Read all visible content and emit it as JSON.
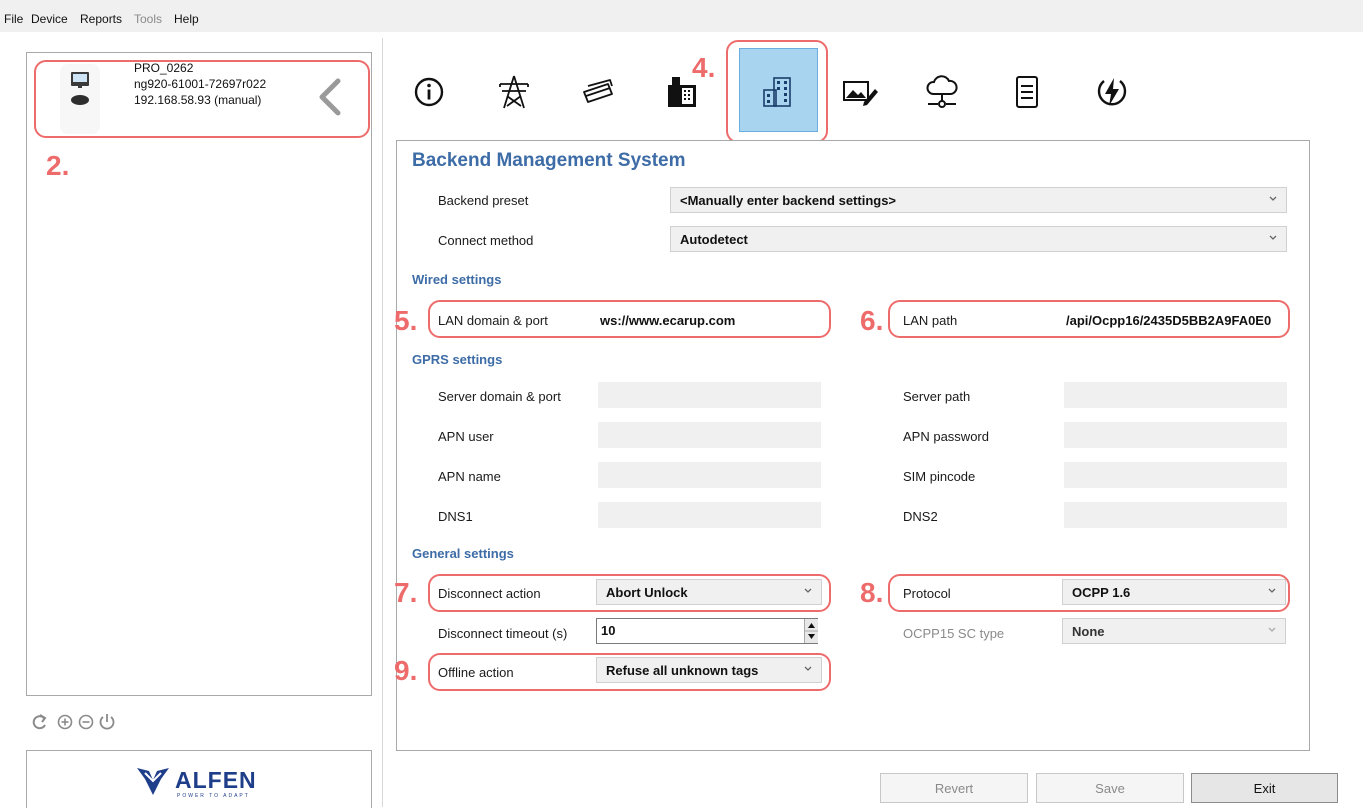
{
  "menu": {
    "file": "File",
    "device": "Device",
    "reports": "Reports",
    "tools": "Tools",
    "help": "Help"
  },
  "device": {
    "name": "PRO_0262",
    "id": "ng920-61001-72697r022",
    "address": "192.168.58.93 (manual)"
  },
  "annotations": {
    "n2": "2.",
    "n4": "4.",
    "n5": "5.",
    "n6": "6.",
    "n7": "7.",
    "n8": "8.",
    "n9": "9."
  },
  "toolbar": {
    "icons": [
      "info-icon",
      "power-tower-icon",
      "cards-icon",
      "cash-register-icon",
      "buildings-icon",
      "image-edit-icon",
      "cloud-network-icon",
      "document-icon",
      "power-bolt-icon"
    ],
    "selected_index": 4
  },
  "backend": {
    "title": "Backend Management System",
    "preset_label": "Backend preset",
    "preset_value": "<Manually enter backend settings>",
    "connect_label": "Connect method",
    "connect_value": "Autodetect"
  },
  "wired": {
    "title": "Wired settings",
    "lan_domain_label": "LAN domain & port",
    "lan_domain_value": "ws://www.ecarup.com",
    "lan_path_label": "LAN path",
    "lan_path_value": "/api/Ocpp16/2435D5BB2A9FA0E0"
  },
  "gprs": {
    "title": "GPRS settings",
    "server_domain_label": "Server domain & port",
    "server_domain_value": "",
    "server_path_label": "Server path",
    "server_path_value": "",
    "apn_user_label": "APN user",
    "apn_user_value": "",
    "apn_password_label": "APN password",
    "apn_password_value": "",
    "apn_name_label": "APN name",
    "apn_name_value": "",
    "sim_pincode_label": "SIM pincode",
    "sim_pincode_value": "",
    "dns1_label": "DNS1",
    "dns1_value": "",
    "dns2_label": "DNS2",
    "dns2_value": ""
  },
  "general": {
    "title": "General settings",
    "disconnect_action_label": "Disconnect action",
    "disconnect_action_value": "Abort Unlock",
    "protocol_label": "Protocol",
    "protocol_value": "OCPP 1.6",
    "disconnect_timeout_label": "Disconnect timeout (s)",
    "disconnect_timeout_value": "10",
    "ocpp15_label": "OCPP15 SC type",
    "ocpp15_value": "None",
    "offline_action_label": "Offline action",
    "offline_action_value": "Refuse all unknown tags"
  },
  "buttons": {
    "revert": "Revert",
    "save": "Save",
    "exit": "Exit"
  },
  "logo": {
    "brand": "ALFEN",
    "tagline": "POWER TO ADAPT"
  },
  "colors": {
    "accent": "#3d6ca6",
    "annotation": "#ee6b6b",
    "selected_tab": "#a8d4ef"
  }
}
